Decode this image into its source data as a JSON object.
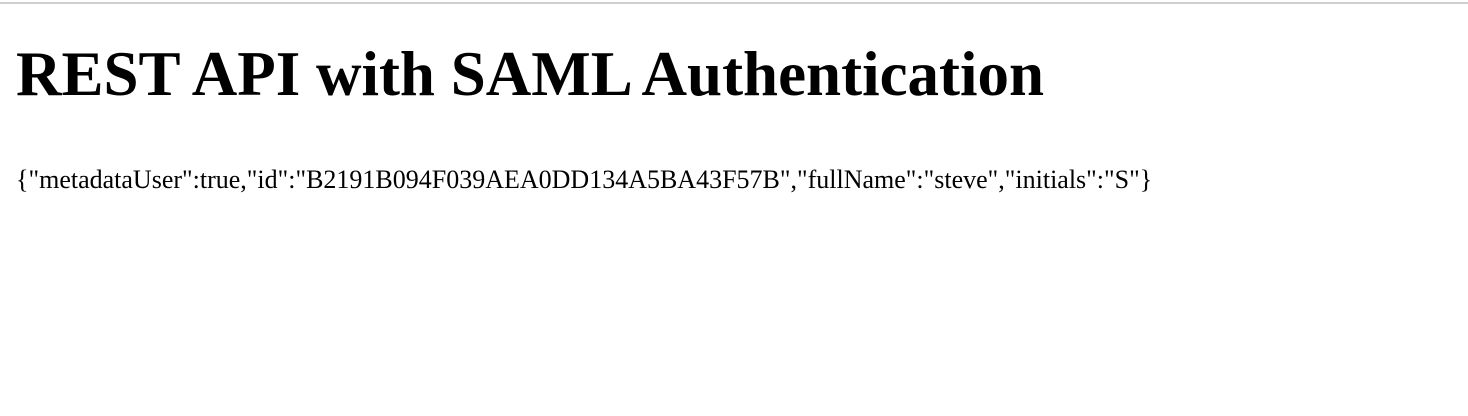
{
  "page": {
    "title": "REST API with SAML Authentication",
    "response_json": "{\"metadataUser\":true,\"id\":\"B2191B094F039AEA0DD134A5BA43F57B\",\"fullName\":\"steve\",\"initials\":\"S\"}"
  },
  "colors": {
    "background": "#ffffff",
    "text": "#000000",
    "divider": "#cfcfcf"
  }
}
